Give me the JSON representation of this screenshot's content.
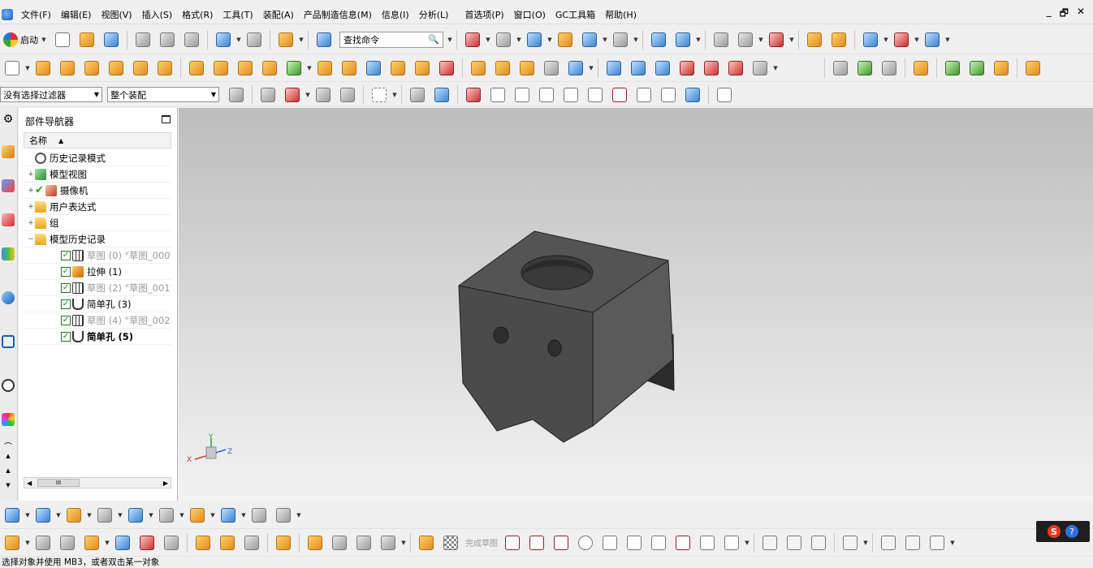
{
  "menubar": {
    "items": [
      "文件(F)",
      "编辑(E)",
      "视图(V)",
      "插入(S)",
      "格式(R)",
      "工具(T)",
      "装配(A)",
      "产品制造信息(M)",
      "信息(I)",
      "分析(L)",
      "首选项(P)",
      "窗口(O)",
      "GC工具箱",
      "帮助(H)"
    ],
    "window_controls": [
      "_",
      "🗗",
      "✕"
    ]
  },
  "toolbar1": {
    "start_label": "启动",
    "search_value": "查找命令",
    "search_icon": "magnifier-icon"
  },
  "toolbar3": {
    "filter_value": "没有选择过滤器",
    "scope_value": "整个装配"
  },
  "navigator": {
    "title": "部件导航器",
    "column_header": "名称",
    "sort_indicator": "▲",
    "rows": [
      {
        "label": "历史记录模式",
        "icon": "clock-icon",
        "indent": 1,
        "expand": "",
        "checkbox": false,
        "style": "normal"
      },
      {
        "label": "模型视图",
        "icon": "cube-icon",
        "indent": 1,
        "expand": "+",
        "checkbox": false,
        "style": "normal"
      },
      {
        "label": "摄像机",
        "icon": "camera-icon",
        "indent": 1,
        "expand": "+",
        "checkbox": false,
        "tick": true,
        "style": "normal"
      },
      {
        "label": "用户表达式",
        "icon": "folder-icon",
        "indent": 1,
        "expand": "+",
        "checkbox": false,
        "style": "normal"
      },
      {
        "label": "组",
        "icon": "folder-icon",
        "indent": 1,
        "expand": "+",
        "checkbox": false,
        "style": "normal"
      },
      {
        "label": "模型历史记录",
        "icon": "folder-icon",
        "indent": 1,
        "expand": "−",
        "checkbox": false,
        "style": "normal"
      },
      {
        "label": "草图 (0) \"草图_000\"",
        "icon": "sketch-icon",
        "indent": 2,
        "expand": "",
        "checkbox": true,
        "style": "faded"
      },
      {
        "label": "拉伸 (1)",
        "icon": "extrude-icon",
        "indent": 2,
        "expand": "",
        "checkbox": true,
        "style": "normal"
      },
      {
        "label": "草图 (2) \"草图_001\"",
        "icon": "sketch-icon",
        "indent": 2,
        "expand": "",
        "checkbox": true,
        "style": "faded"
      },
      {
        "label": "简单孔 (3)",
        "icon": "hole-icon",
        "indent": 2,
        "expand": "",
        "checkbox": true,
        "style": "normal"
      },
      {
        "label": "草图 (4) \"草图_002\"",
        "icon": "sketch-icon",
        "indent": 2,
        "expand": "",
        "checkbox": true,
        "style": "faded"
      },
      {
        "label": "简单孔 (5)",
        "icon": "hole-icon",
        "indent": 2,
        "expand": "",
        "checkbox": true,
        "style": "bold"
      }
    ],
    "scroll_thumb_label": "III"
  },
  "viewport": {
    "triad": {
      "x_label": "X",
      "y_label": "Y",
      "z_label": "Z"
    },
    "colors": {
      "model_top": "#545454",
      "model_front": "#4b4b4b",
      "model_right": "#5a5a5a",
      "model_edge": "#1e1e1e",
      "hole": "#3a3a3a"
    }
  },
  "toolbar5": {
    "finish_sketch_label": "完成草图"
  },
  "statusbar": {
    "message": "选择对象并使用 MB3，或者双击某一对象"
  },
  "ime": {
    "s_label": "S",
    "help_label": "?"
  }
}
